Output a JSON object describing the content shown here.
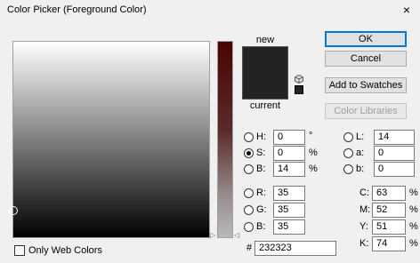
{
  "window": {
    "title": "Color Picker (Foreground Color)",
    "close_glyph": "×"
  },
  "swatch": {
    "new_label": "new",
    "current_label": "current",
    "new_color": "#232323",
    "current_color": "#232323"
  },
  "buttons": {
    "ok": "OK",
    "cancel": "Cancel",
    "add_to_swatches": "Add to Swatches",
    "color_libraries": "Color Libraries"
  },
  "hsb": {
    "h": {
      "label": "H:",
      "value": "0",
      "unit": "°"
    },
    "s": {
      "label": "S:",
      "value": "0",
      "unit": "%"
    },
    "b": {
      "label": "B:",
      "value": "14",
      "unit": "%"
    }
  },
  "rgb": {
    "r": {
      "label": "R:",
      "value": "35"
    },
    "g": {
      "label": "G:",
      "value": "35"
    },
    "b": {
      "label": "B:",
      "value": "35"
    }
  },
  "lab": {
    "l": {
      "label": "L:",
      "value": "14"
    },
    "a": {
      "label": "a:",
      "value": "0"
    },
    "b": {
      "label": "b:",
      "value": "0"
    }
  },
  "cmyk": {
    "c": {
      "label": "C:",
      "value": "63",
      "unit": "%"
    },
    "m": {
      "label": "M:",
      "value": "52",
      "unit": "%"
    },
    "y": {
      "label": "Y:",
      "value": "51",
      "unit": "%"
    },
    "k": {
      "label": "K:",
      "value": "74",
      "unit": "%"
    }
  },
  "hex": {
    "label": "#",
    "value": "232323"
  },
  "only_web_colors": {
    "label": "Only Web Colors",
    "checked": false
  },
  "selected_channel": "S"
}
